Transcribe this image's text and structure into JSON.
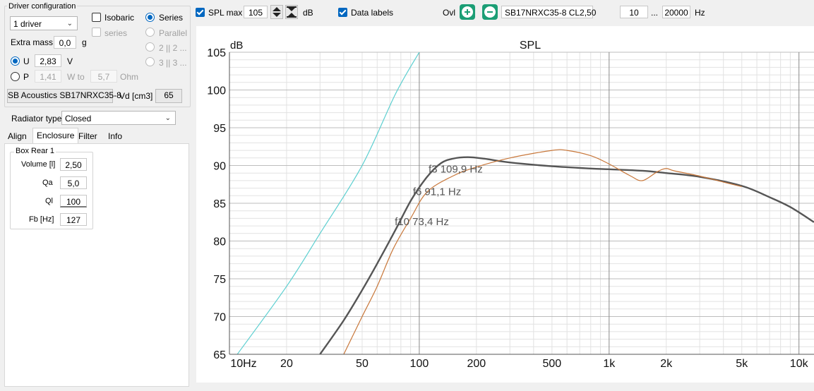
{
  "left_panel": {
    "driver_config": {
      "title": "Driver configuration",
      "driver_count": "1 driver",
      "isobaric_label": "Isobaric",
      "series_chk_label": "series",
      "series_radio": "Series",
      "parallel_radio": "Parallel",
      "opt_2": "2 || 2 ...",
      "opt_3": "3 || 3 ...",
      "extra_mass_label": "Extra mass",
      "extra_mass_value": "0,0",
      "extra_mass_unit": "g",
      "u_label": "U",
      "u_value": "2,83",
      "u_unit": "V",
      "p_label": "P",
      "p_value": "1,41",
      "w_to_label": "W to",
      "p_max": "5,7",
      "p_unit": "Ohm",
      "driver_name": "SB Acoustics SB17NRXC35-8",
      "vd_label": "Vd [cm3]",
      "vd_value": "65"
    },
    "radiator_type_label": "Radiator type",
    "radiator_type_value": "Closed",
    "tabs": [
      "Align",
      "Enclosure",
      "Filter",
      "Info"
    ],
    "box": {
      "title": "Box Rear 1",
      "volume_label": "Volume [l]",
      "volume_value": "2,50",
      "qa_label": "Qa",
      "qa_value": "5,0",
      "ql_label": "Ql",
      "ql_value": "100",
      "fb_label": "Fb [Hz]",
      "fb_value": "127"
    }
  },
  "toolbar": {
    "spl_max_label": "SPL max",
    "spl_max_value": "105",
    "spl_unit": "dB",
    "data_labels_label": "Data labels",
    "ovl_label": "Ovl",
    "overlay_name": "SB17NRXC35-8 CL2,50",
    "freq_min": "10",
    "freq_sep": "...",
    "freq_max": "20000",
    "freq_unit": "Hz"
  },
  "colors": {
    "accent": "#0067c0",
    "ovl_button": "#1b9e75",
    "spl_curve": "#555555",
    "overlay_curve": "#c8773a",
    "cone_curve": "#5ccfd0"
  },
  "chart_data": {
    "type": "line",
    "title": "SPL",
    "ylabel": "dB",
    "xscale": "log",
    "xlim": [
      10,
      12000
    ],
    "ylim": [
      65,
      105
    ],
    "xticks": [
      10,
      20,
      50,
      100,
      200,
      500,
      1000,
      2000,
      5000,
      10000
    ],
    "xtick_labels": [
      "10Hz",
      "20",
      "50",
      "100",
      "200",
      "500",
      "1k",
      "2k",
      "5k",
      "10k"
    ],
    "yticks": [
      65,
      70,
      75,
      80,
      85,
      90,
      95,
      100,
      105
    ],
    "ytick_labels": [
      "65",
      "70",
      "75",
      "80",
      "85",
      "90",
      "95",
      "100",
      "105"
    ],
    "grid": true,
    "series": [
      {
        "color": "#5ccfd0",
        "x": [
          11,
          20,
          30,
          50,
          75,
          100
        ],
        "y": [
          65,
          74,
          81,
          90,
          99.5,
          105
        ]
      },
      {
        "color": "#555555",
        "x": [
          30,
          40,
          50,
          60,
          75,
          91,
          110,
          130,
          150,
          180,
          220,
          300,
          500,
          800,
          1000,
          1500,
          2000,
          3000,
          5000,
          7000,
          9000,
          12000
        ],
        "y": [
          65,
          69.5,
          73.5,
          77,
          81.5,
          85.5,
          88.5,
          90.3,
          90.9,
          91.1,
          90.9,
          90.4,
          89.9,
          89.6,
          89.5,
          89.3,
          89.0,
          88.5,
          87.3,
          85.8,
          84.5,
          82.5
        ]
      },
      {
        "color": "#c8773a",
        "x": [
          40,
          50,
          60,
          73,
          90,
          110,
          150,
          200,
          300,
          500,
          600,
          800,
          1000,
          1300,
          1500,
          1800,
          2000,
          2200,
          3000,
          4000,
          5000
        ],
        "y": [
          65,
          70,
          74,
          79,
          83,
          86.5,
          88.6,
          89.8,
          91,
          92,
          92,
          91.3,
          90.2,
          88.6,
          88.0,
          89.2,
          89.6,
          89.3,
          88.6,
          87.8,
          87.2
        ]
      }
    ],
    "annotations": [
      {
        "text": "f3 109,9 Hz",
        "x": 110,
        "y": 88.9
      },
      {
        "text": "f6 91,1 Hz",
        "x": 91,
        "y": 85.9
      },
      {
        "text": "f10 73,4 Hz",
        "x": 73,
        "y": 81.9
      }
    ]
  }
}
